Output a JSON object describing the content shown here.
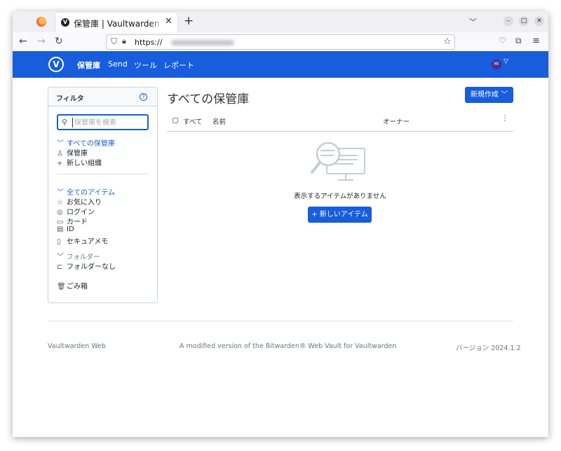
{
  "browser": {
    "tab_title": "保管庫 | Vaultwarden Web",
    "url_prefix": "https://"
  },
  "header": {
    "nav": [
      "保管庫",
      "Send",
      "ツール",
      "レポート"
    ],
    "avatar_initials": "MI"
  },
  "filter": {
    "title": "フィルタ",
    "search_placeholder": "保管庫を検索",
    "all_vaults": "すべての保管庫",
    "my_vault": "保管庫",
    "new_org": "新しい組織",
    "all_items": "全てのアイテム",
    "favorites": "お気に入り",
    "login": "ログイン",
    "card": "カード",
    "identity": "ID",
    "secure_note": "セキュアメモ",
    "folders": "フォルダー",
    "no_folder": "フォルダーなし",
    "trash": "ごみ箱"
  },
  "main": {
    "title": "すべての保管庫",
    "new_button": "新規作成",
    "columns": {
      "all": "すべて",
      "name": "名前",
      "owner": "オーナー"
    },
    "empty_message": "表示するアイテムがありません",
    "new_item_button": "新しいアイテム"
  },
  "footer": {
    "left": "Vaultwarden Web",
    "center": "A modified version of the Bitwarden® Web Vault for Vaultwarden",
    "version": "バージョン 2024.1.2"
  },
  "colors": {
    "brand": "#175ddc"
  },
  "icons": [
    "firefox-logo",
    "vaultwarden-logo",
    "search-icon",
    "help-icon",
    "user-icon",
    "plus-icon",
    "star-icon",
    "globe-icon",
    "card-icon",
    "id-icon",
    "note-icon",
    "folder-icon",
    "trash-icon",
    "kebab-icon"
  ]
}
